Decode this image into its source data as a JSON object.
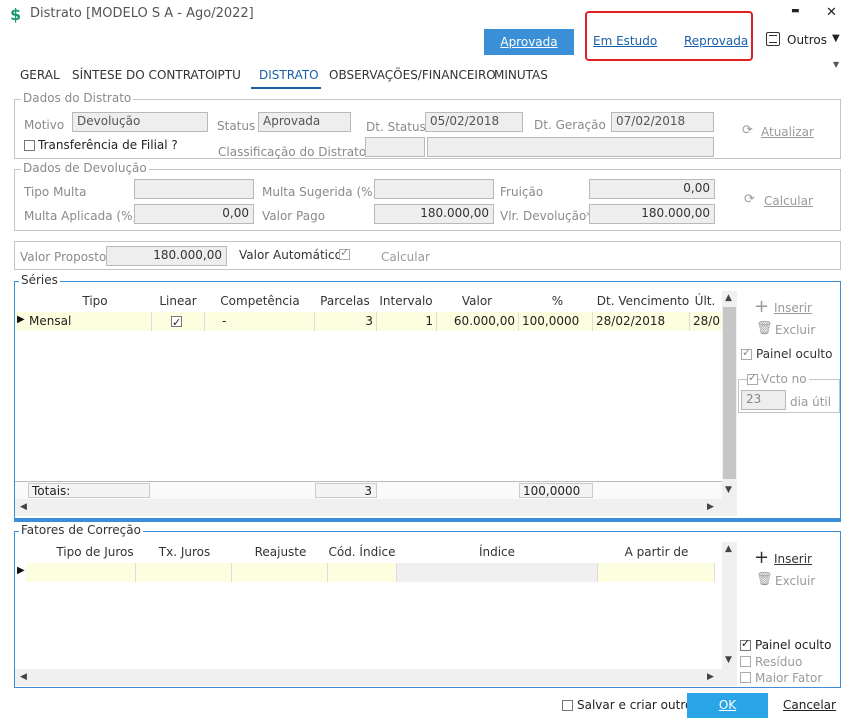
{
  "window": {
    "title": "Distrato [MODELO S A - Ago/2022]",
    "minimize": "▬",
    "close": "✕"
  },
  "toolbar": {
    "aprovada": "Aprovada",
    "em_estudo": "Em Estudo",
    "reprovada": "Reprovada",
    "outros": "Outros"
  },
  "tabs": [
    "GERAL",
    "SÍNTESE DO CONTRATO",
    "IPTU",
    "DISTRATO",
    "OBSERVAÇÕES/FINANCEIRO",
    "MINUTAS"
  ],
  "dados_distrato": {
    "title": "Dados do Distrato",
    "motivo_label": "Motivo",
    "motivo": "Devolução",
    "status_label": "Status",
    "status": "Aprovada",
    "dt_status_label": "Dt. Status",
    "dt_status": "05/02/2018",
    "dt_geracao_label": "Dt. Geração",
    "dt_geracao": "07/02/2018",
    "transferencia_label": "Transferência de Filial ?",
    "classificacao_label": "Classificação do Distrato",
    "atualizar": "Atualizar"
  },
  "dados_devolucao": {
    "title": "Dados de Devolução",
    "tipo_multa_label": "Tipo Multa",
    "multa_sugerida_label": "Multa Sugerida (%)",
    "fruicao_label": "Fruição",
    "fruicao": "0,00",
    "multa_aplicada_label": "Multa Aplicada (%)",
    "multa_aplicada": "0,00",
    "valor_pago_label": "Valor Pago",
    "valor_pago": "180.000,00",
    "vlr_devolucao_label": "Vlr. Devolução*",
    "vlr_devolucao": "180.000,00",
    "calcular": "Calcular"
  },
  "proposto": {
    "valor_proposto_label": "Valor Proposto",
    "valor_proposto": "180.000,00",
    "valor_automatico_label": "Valor Automático",
    "calcular": "Calcular"
  },
  "series": {
    "title": "Séries",
    "columns": [
      "Tipo",
      "Linear",
      "Competência",
      "Parcelas",
      "Intervalo",
      "Valor",
      "%",
      "Dt. Vencimento",
      "Últ."
    ],
    "row": {
      "tipo": "Mensal",
      "competencia": "-",
      "parcelas": "3",
      "intervalo": "1",
      "valor": "60.000,00",
      "pct": "100,0000",
      "dt_vencimento": "28/02/2018",
      "ult": "28/0"
    },
    "totais_label": "Totais:",
    "totais_parcelas": "3",
    "totais_pct": "100,0000",
    "inserir": "Inserir",
    "excluir": "Excluir",
    "painel_oculto": "Painel oculto",
    "vcto_no": "Vcto no",
    "dia_value": "23",
    "dia_util": "dia útil"
  },
  "fatores": {
    "title": "Fatores de Correção",
    "columns": [
      "Tipo de Juros",
      "Tx. Juros",
      "Reajuste",
      "Cód. Índice",
      "Índice",
      "A partir de"
    ],
    "inserir": "Inserir",
    "excluir": "Excluir",
    "painel_oculto": "Painel oculto",
    "residuo": "Resíduo",
    "maior_fator": "Maior Fator"
  },
  "footer": {
    "salvar_criar": "Salvar e criar outro",
    "ok": "OK",
    "cancelar": "Cancelar"
  },
  "colors": {
    "accent": "#3a8fd6",
    "highlight_border": "#e02020",
    "link": "#1a5fa8",
    "row_highlight": "#fdfde0"
  }
}
